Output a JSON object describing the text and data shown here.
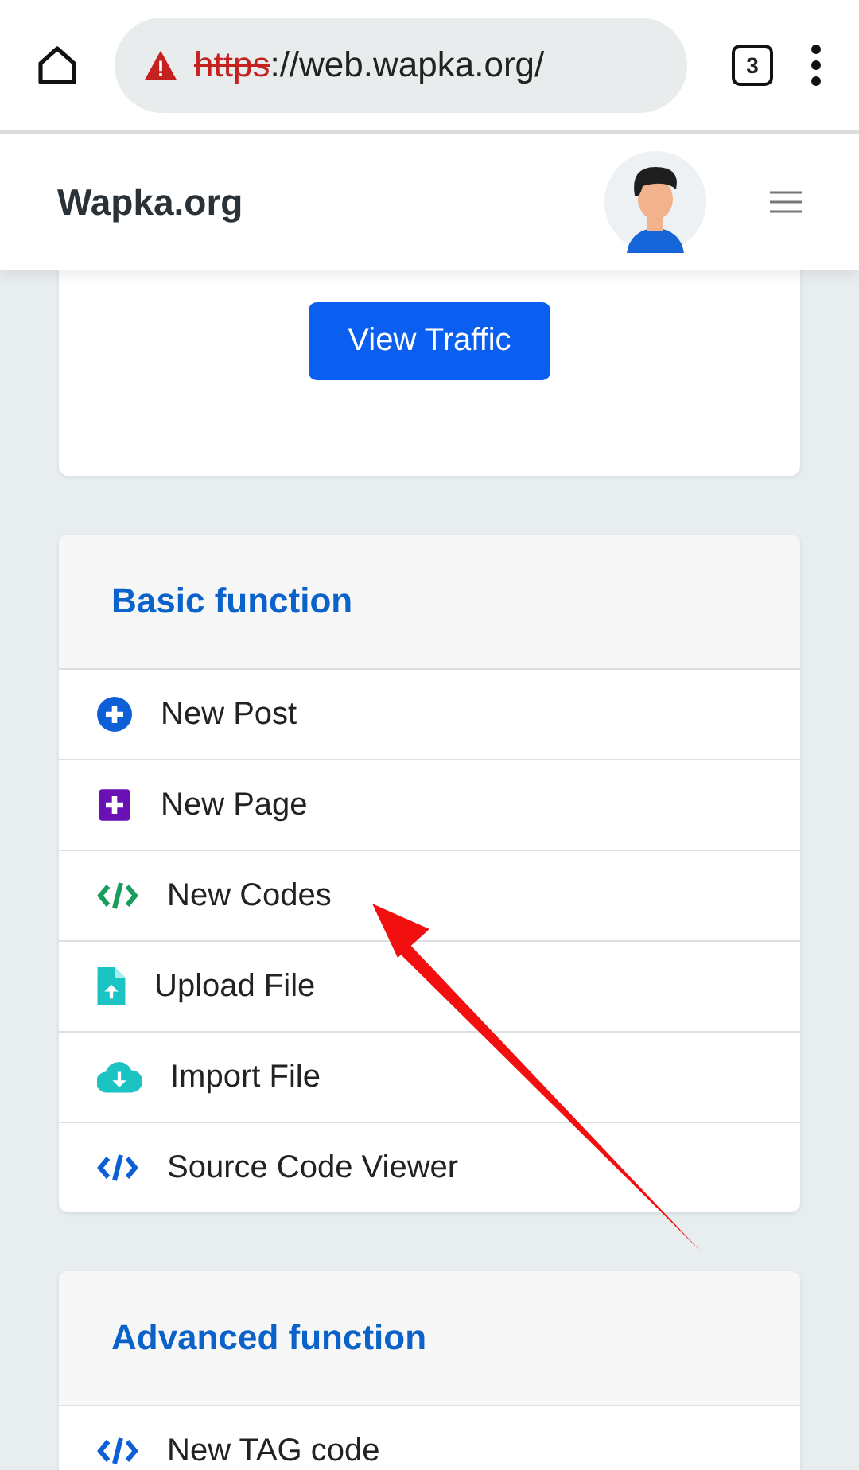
{
  "browser": {
    "url_scheme": "https",
    "url_rest": "://web.wapka.org/",
    "insecure": true,
    "tab_count": "3"
  },
  "header": {
    "brand": "Wapka.org"
  },
  "traffic_card": {
    "button": "View Traffic"
  },
  "sections": [
    {
      "title": "Basic function",
      "items": [
        {
          "label": "New Post",
          "kind": "plus-circle"
        },
        {
          "label": "New Page",
          "kind": "plus-square"
        },
        {
          "label": "New Codes",
          "kind": "code-green"
        },
        {
          "label": "Upload File",
          "kind": "file-upload"
        },
        {
          "label": "Import File",
          "kind": "cloud-download"
        },
        {
          "label": "Source Code Viewer",
          "kind": "code-blue"
        }
      ]
    },
    {
      "title": "Advanced function",
      "items": [
        {
          "label": "New TAG code",
          "kind": "code-blue"
        }
      ]
    }
  ],
  "annotation": {
    "kind": "arrow"
  }
}
